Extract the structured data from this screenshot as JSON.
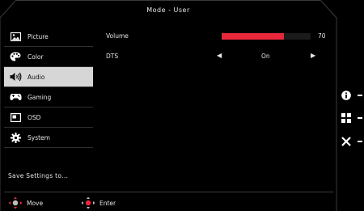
{
  "header": {
    "title": "Mode  -  User"
  },
  "menu": {
    "items": [
      {
        "label": "Picture",
        "icon": "picture-icon",
        "active": false
      },
      {
        "label": "Color",
        "icon": "palette-icon",
        "active": false
      },
      {
        "label": "Audio",
        "icon": "speaker-icon",
        "active": true
      },
      {
        "label": "Gaming",
        "icon": "gamepad-icon",
        "active": false
      },
      {
        "label": "OSD",
        "icon": "osd-icon",
        "active": false
      },
      {
        "label": "System",
        "icon": "gear-icon",
        "active": false
      }
    ]
  },
  "settings": {
    "volume": {
      "label": "Volume",
      "value": "70",
      "level": 0.7,
      "fill_color": "#e8283a"
    },
    "dts": {
      "label": "DTS",
      "value": "On"
    }
  },
  "save": {
    "label": "Save  Settings  to..."
  },
  "footer": {
    "move_label": "Move",
    "enter_label": "Enter"
  },
  "side_keys": [
    "info-icon",
    "grid-icon",
    "close-icon"
  ],
  "colors": {
    "accent": "#e8283a",
    "active_bg": "#d6d6d6"
  }
}
